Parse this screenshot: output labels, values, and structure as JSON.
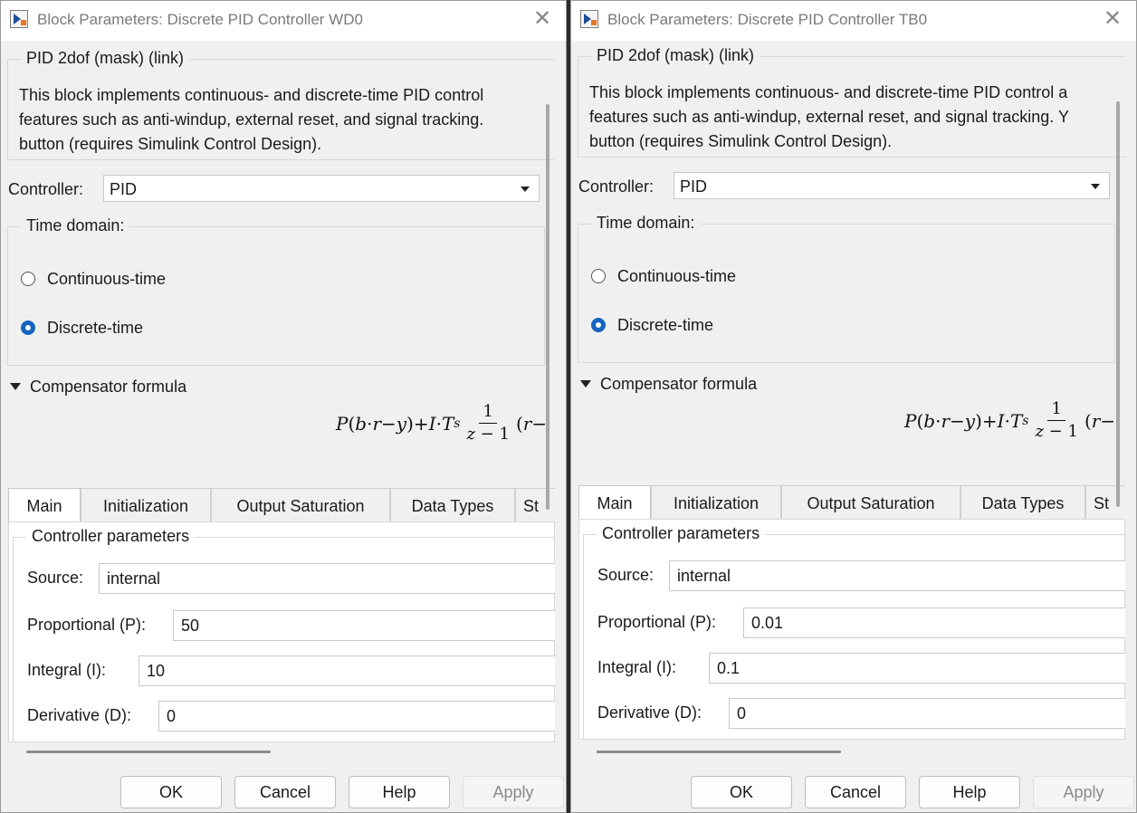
{
  "dialogs": [
    {
      "title": "Block Parameters: Discrete PID Controller WD0",
      "mask_label": "PID 2dof (mask) (link)",
      "description": [
        "This block implements continuous- and discrete-time PID control",
        "features such as anti-windup, external reset, and signal tracking.",
        "button (requires Simulink Control Design)."
      ],
      "controller_label": "Controller:",
      "controller_value": "PID",
      "time_domain_label": "Time domain:",
      "time_options": [
        "Continuous-time",
        "Discrete-time"
      ],
      "selected_time_option": "Discrete-time",
      "compensator_label": "Compensator formula",
      "tabs": [
        "Main",
        "Initialization",
        "Output Saturation",
        "Data Types",
        "St"
      ],
      "active_tab": "Main",
      "params_group_label": "Controller parameters",
      "source_label": "Source:",
      "source_value": "internal",
      "p_label": "Proportional (P):",
      "p_value": "50",
      "i_label": "Integral (I):",
      "i_value": "10",
      "d_label": "Derivative (D):",
      "d_value": "0",
      "buttons": {
        "ok": "OK",
        "cancel": "Cancel",
        "help": "Help",
        "apply": "Apply"
      }
    },
    {
      "title": "Block Parameters: Discrete PID Controller TB0",
      "mask_label": "PID 2dof (mask) (link)",
      "description": [
        "This block implements continuous- and discrete-time PID control a",
        "features such as anti-windup, external reset, and signal tracking. Y",
        "button (requires Simulink Control Design)."
      ],
      "controller_label": "Controller:",
      "controller_value": "PID",
      "time_domain_label": "Time domain:",
      "time_options": [
        "Continuous-time",
        "Discrete-time"
      ],
      "selected_time_option": "Discrete-time",
      "compensator_label": "Compensator formula",
      "tabs": [
        "Main",
        "Initialization",
        "Output Saturation",
        "Data Types",
        "St"
      ],
      "active_tab": "Main",
      "params_group_label": "Controller parameters",
      "source_label": "Source:",
      "source_value": "internal",
      "p_label": "Proportional (P):",
      "p_value": "0.01",
      "i_label": "Integral (I):",
      "i_value": "0.1",
      "d_label": "Derivative (D):",
      "d_value": "0",
      "buttons": {
        "ok": "OK",
        "cancel": "Cancel",
        "help": "Help",
        "apply": "Apply"
      }
    }
  ],
  "formula": {
    "P": "P",
    "open1": "(",
    "b": "b",
    "dot1": "·",
    "r1": "r",
    "minus1": " − ",
    "y": "y",
    "close1": ")",
    "plus": " + ",
    "I": "I",
    "dot2": "·",
    "T": "T",
    "sub_s": "s",
    "num": "1",
    "z": "z",
    "minus2": " − ",
    "one": "1",
    "open2": "(",
    "r2": "r",
    "minus3": " −"
  },
  "colors": {
    "accent": "#1565c0",
    "background": "#f0f0f0"
  }
}
